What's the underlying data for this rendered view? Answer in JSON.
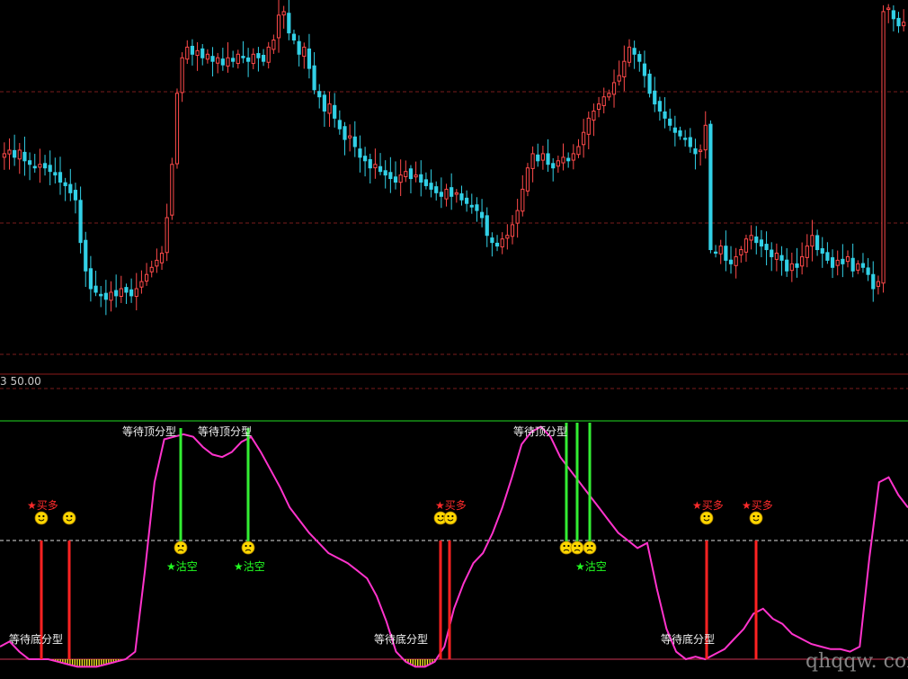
{
  "colors": {
    "background": "#000000",
    "up": "#ff4a4a",
    "down": "#32d0e6",
    "grid": "#7a1b1b",
    "separator": "#8b1a1a",
    "upper_line": "#22dd22",
    "lower_line": "#cc3355",
    "mid_line": "#e0e0e0",
    "oscillator": "#ff33cc",
    "buy_bar": "#ff2222",
    "sell_bar": "#33ee33",
    "top_fill": "#ffffff",
    "bottom_fill": "#ffee22",
    "smiley": "#ffd700"
  },
  "header": {
    "indicator_value": "3 50.00"
  },
  "watermark": "qhqqw. com",
  "chart_data": [
    {
      "type": "candlestick",
      "title": "",
      "xlabel": "",
      "ylabel": "",
      "grid": true,
      "ylim": [
        0,
        100
      ],
      "closes": [
        58,
        59,
        57,
        59,
        56,
        55,
        54,
        55,
        54,
        53,
        52,
        50,
        49,
        47,
        45,
        33,
        25,
        20,
        19,
        18,
        17,
        19,
        18,
        20,
        19,
        18,
        20,
        22,
        24,
        26,
        28,
        30,
        40,
        55,
        75,
        85,
        88,
        86,
        87,
        85,
        86,
        84,
        85,
        83,
        85,
        84,
        86,
        85,
        84,
        86,
        85,
        84,
        88,
        90,
        97,
        98,
        92,
        90,
        86,
        88,
        82,
        76,
        74,
        70,
        72,
        68,
        65,
        62,
        63,
        60,
        57,
        56,
        54,
        55,
        53,
        52,
        51,
        50,
        52,
        53,
        51,
        52,
        50,
        49,
        48,
        47,
        46,
        48,
        46,
        47,
        45,
        44,
        43,
        42,
        40,
        35,
        33,
        32,
        34,
        35,
        38,
        42,
        48,
        54,
        58,
        56,
        58,
        55,
        54,
        56,
        57,
        56,
        58,
        60,
        64,
        68,
        70,
        72,
        74,
        75,
        78,
        80,
        84,
        88,
        86,
        84,
        80,
        75,
        72,
        70,
        68,
        66,
        64,
        63,
        62,
        60,
        58,
        59,
        66,
        31,
        30,
        32,
        28,
        27,
        29,
        31,
        34,
        35,
        33,
        32,
        31,
        29,
        30,
        28,
        25,
        27,
        26,
        29,
        32,
        35,
        31,
        30,
        28,
        26,
        28,
        27,
        29,
        25,
        27,
        26,
        24,
        20,
        22,
        98,
        99,
        96,
        94,
        95
      ]
    },
    {
      "type": "line",
      "title": "",
      "xlabel": "",
      "ylabel": "",
      "ylim": [
        0,
        100
      ],
      "upper_level": 80,
      "mid_level": 45,
      "lower_level": 0,
      "series": [
        {
          "values": [
            5,
            7,
            3,
            0,
            0,
            0,
            -1,
            -2,
            -3,
            -3,
            -3,
            -2,
            -1,
            0,
            3,
            35,
            70,
            87,
            88,
            89,
            88,
            84,
            81,
            80,
            82,
            86,
            88,
            82,
            75,
            68,
            60,
            55,
            50,
            46,
            42,
            40,
            38,
            35,
            32,
            25,
            15,
            3,
            -1,
            -3,
            -3,
            -1,
            5,
            20,
            30,
            38,
            42,
            50,
            60,
            72,
            85,
            90,
            92,
            88,
            80,
            75,
            70,
            65,
            60,
            55,
            50,
            47,
            44,
            46,
            28,
            12,
            3,
            0,
            1,
            0,
            2,
            4,
            8,
            12,
            18,
            20,
            16,
            14,
            10,
            8,
            6,
            5,
            4,
            4,
            3,
            5,
            40,
            70,
            72,
            65,
            60
          ]
        }
      ]
    }
  ],
  "annotations": {
    "top_pattern": "等待顶分型",
    "bottom_pattern": "等待底分型",
    "buy": "★买多",
    "sell": "★沽空"
  }
}
